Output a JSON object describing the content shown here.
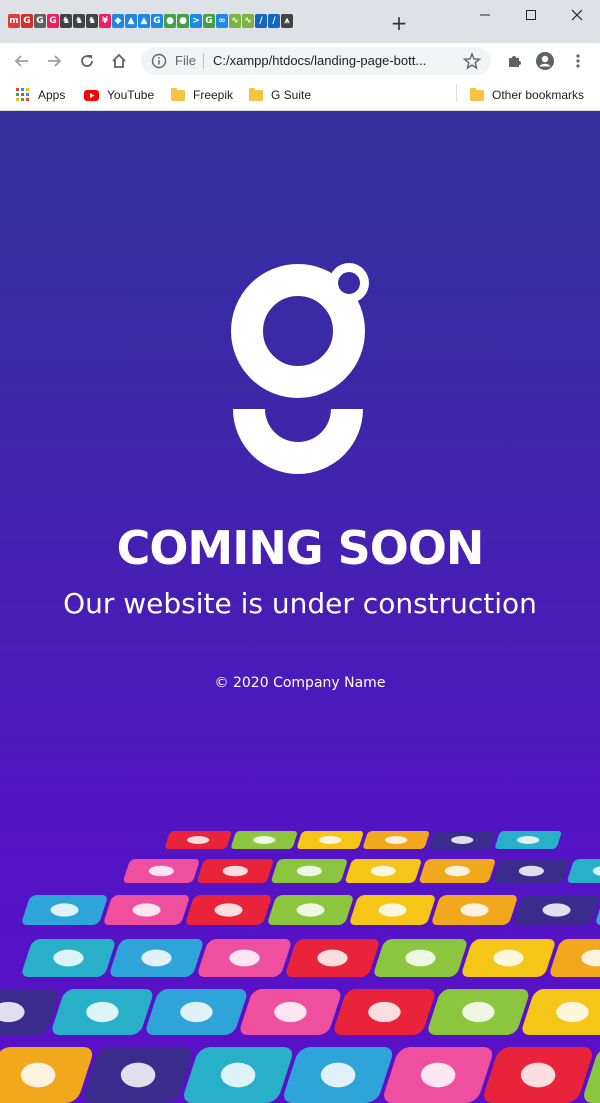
{
  "browser": {
    "new_tab_symbol": "+",
    "window_controls": {
      "minimize": "—",
      "maximize": "☐",
      "close": "✕"
    },
    "omnibox": {
      "scheme_label": "File",
      "url": "C:/xampp/htdocs/landing-page-bott..."
    },
    "bookmarks": [
      {
        "label": "Apps",
        "icon": "apps-grid-icon"
      },
      {
        "label": "YouTube",
        "icon": "youtube-icon"
      },
      {
        "label": "Freepik",
        "icon": "folder-icon"
      },
      {
        "label": "G Suite",
        "icon": "folder-icon"
      }
    ],
    "other_bookmarks": "Other bookmarks",
    "tab_favicons": [
      {
        "glyph": "m",
        "color": "#e53935"
      },
      {
        "glyph": "G",
        "color": "#d32f2f"
      },
      {
        "glyph": "G",
        "color": "#616161"
      },
      {
        "glyph": "G",
        "color": "#e91e63"
      },
      {
        "glyph": "♞",
        "color": "#424242"
      },
      {
        "glyph": "♞",
        "color": "#424242"
      },
      {
        "glyph": "♞",
        "color": "#424242"
      },
      {
        "glyph": "¥",
        "color": "#e91e63"
      },
      {
        "glyph": "◆",
        "color": "#1e88e5"
      },
      {
        "glyph": "▲",
        "color": "#1e88e5"
      },
      {
        "glyph": "▲",
        "color": "#1e88e5"
      },
      {
        "glyph": "G",
        "color": "#1e88e5"
      },
      {
        "glyph": "●",
        "color": "#43a047"
      },
      {
        "glyph": "●",
        "color": "#43a047"
      },
      {
        "glyph": ">",
        "color": "#1e88e5"
      },
      {
        "glyph": "G",
        "color": "#43a047"
      },
      {
        "glyph": "∞",
        "color": "#1e88e5"
      },
      {
        "glyph": "∿",
        "color": "#7cb342"
      },
      {
        "glyph": "∿",
        "color": "#7cb342"
      },
      {
        "glyph": "∕",
        "color": "#1565c0"
      },
      {
        "glyph": "∕",
        "color": "#1565c0"
      },
      {
        "glyph": "⩚",
        "color": "#424242"
      }
    ]
  },
  "page": {
    "headline": "COMING SOON",
    "subheading": "Our website is under construction",
    "copyright": "© 2020 Company Name",
    "colors": {
      "bg_top": "#33309e",
      "bg_bottom": "#5a10c8",
      "text": "#ffffff"
    }
  }
}
